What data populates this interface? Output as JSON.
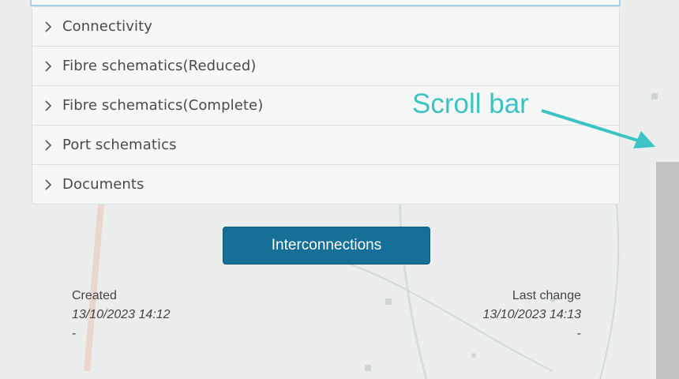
{
  "accordion": {
    "items": [
      {
        "label": "Connectivity"
      },
      {
        "label": "Fibre schematics(Reduced)"
      },
      {
        "label": "Fibre schematics(Complete)"
      },
      {
        "label": "Port schematics"
      },
      {
        "label": "Documents"
      }
    ]
  },
  "actions": {
    "interconnections_label": "Interconnections"
  },
  "meta": {
    "created_label": "Created",
    "created_value": "13/10/2023 14:12",
    "created_by": "-",
    "last_change_label": "Last change",
    "last_change_value": "13/10/2023 14:13",
    "last_change_by": "-"
  },
  "annotation": {
    "text": "Scroll bar",
    "color": "#3cc3c3"
  },
  "colors": {
    "accent": "#156f97",
    "panel": "#f6f7f7",
    "border": "#dcdfe1",
    "focus_border": "#a9cfe8"
  },
  "icons": [
    "chevron-right-icon",
    "arrow-icon"
  ]
}
